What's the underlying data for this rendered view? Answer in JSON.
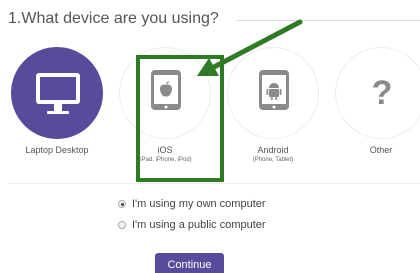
{
  "question": {
    "title": "1.What device are you using?"
  },
  "devices": [
    {
      "label": "Laptop Desktop",
      "sub": "",
      "icon": "monitor-icon",
      "selected": true
    },
    {
      "label": "iOS",
      "sub": "(iPad, iPhone, iPod)",
      "icon": "apple-tablet-icon",
      "selected": false
    },
    {
      "label": "Android",
      "sub": "(Phone, Tablet)",
      "icon": "android-tablet-icon",
      "selected": false
    },
    {
      "label": "Other",
      "sub": "",
      "icon": "question-mark-icon",
      "selected": false
    }
  ],
  "options": [
    {
      "label": "I'm using my own computer",
      "checked": true
    },
    {
      "label": "I'm using a public computer",
      "checked": false
    }
  ],
  "continue_label": "Continue",
  "colors": {
    "accent": "#5a4a9c",
    "highlight": "#2f7a25",
    "icon_gray": "#8a8a8a"
  }
}
